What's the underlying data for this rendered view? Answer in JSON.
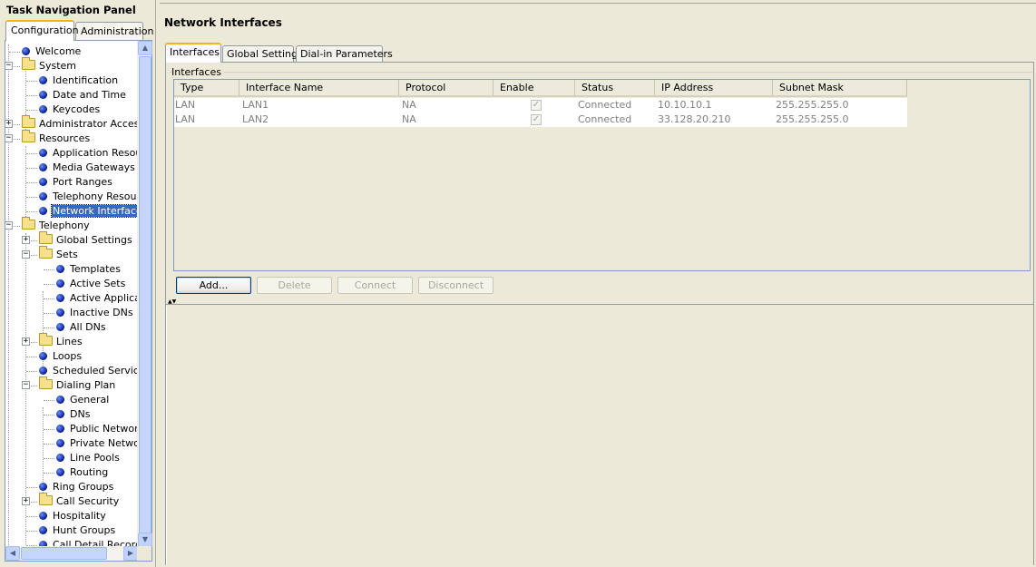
{
  "nav": {
    "title": "Task Navigation Panel",
    "tabs": [
      "Configuration",
      "Administration"
    ],
    "active_tab": "Configuration",
    "tree": [
      {
        "label": "Welcome",
        "kind": "leaf",
        "expander": ""
      },
      {
        "label": "System",
        "kind": "folder",
        "expander": "−"
      },
      {
        "label": "Identification",
        "kind": "leaf",
        "expander": ""
      },
      {
        "label": "Date and Time",
        "kind": "leaf",
        "expander": ""
      },
      {
        "label": "Keycodes",
        "kind": "leaf",
        "expander": ""
      },
      {
        "label": "Administrator Access",
        "kind": "folder",
        "expander": "+"
      },
      {
        "label": "Resources",
        "kind": "folder",
        "expander": "−"
      },
      {
        "label": "Application Resource",
        "kind": "leaf",
        "expander": ""
      },
      {
        "label": "Media Gateways",
        "kind": "leaf",
        "expander": ""
      },
      {
        "label": "Port Ranges",
        "kind": "leaf",
        "expander": ""
      },
      {
        "label": "Telephony Resource",
        "kind": "leaf",
        "expander": ""
      },
      {
        "label": "Network Interfaces",
        "kind": "leaf",
        "expander": "",
        "selected": true
      },
      {
        "label": "Telephony",
        "kind": "folder",
        "expander": "−"
      },
      {
        "label": "Global Settings",
        "kind": "folder",
        "expander": "+"
      },
      {
        "label": "Sets",
        "kind": "folder",
        "expander": "−"
      },
      {
        "label": "Templates",
        "kind": "leaf",
        "expander": ""
      },
      {
        "label": "Active Sets",
        "kind": "leaf",
        "expander": ""
      },
      {
        "label": "Active Applicatio",
        "kind": "leaf",
        "expander": ""
      },
      {
        "label": "Inactive DNs",
        "kind": "leaf",
        "expander": ""
      },
      {
        "label": "All DNs",
        "kind": "leaf",
        "expander": ""
      },
      {
        "label": "Lines",
        "kind": "folder",
        "expander": "+"
      },
      {
        "label": "Loops",
        "kind": "leaf",
        "expander": ""
      },
      {
        "label": "Scheduled Services",
        "kind": "leaf",
        "expander": ""
      },
      {
        "label": "Dialing Plan",
        "kind": "folder",
        "expander": "−"
      },
      {
        "label": "General",
        "kind": "leaf",
        "expander": ""
      },
      {
        "label": "DNs",
        "kind": "leaf",
        "expander": ""
      },
      {
        "label": "Public Network",
        "kind": "leaf",
        "expander": ""
      },
      {
        "label": "Private Network",
        "kind": "leaf",
        "expander": ""
      },
      {
        "label": "Line Pools",
        "kind": "leaf",
        "expander": ""
      },
      {
        "label": "Routing",
        "kind": "leaf",
        "expander": ""
      },
      {
        "label": "Ring Groups",
        "kind": "leaf",
        "expander": ""
      },
      {
        "label": "Call Security",
        "kind": "folder",
        "expander": "+"
      },
      {
        "label": "Hospitality",
        "kind": "leaf",
        "expander": ""
      },
      {
        "label": "Hunt Groups",
        "kind": "leaf",
        "expander": ""
      },
      {
        "label": "Call Detail Recording",
        "kind": "leaf",
        "expander": ""
      }
    ]
  },
  "main": {
    "title": "Network Interfaces",
    "tabs": [
      "Interfaces",
      "Global Settings",
      "Dial-in Parameters"
    ],
    "active_tab": "Interfaces",
    "group_label": "Interfaces",
    "columns": [
      "Type",
      "Interface Name",
      "Protocol",
      "Enable",
      "Status",
      "IP Address",
      "Subnet Mask"
    ],
    "rows": [
      {
        "type": "LAN",
        "name": "LAN1",
        "protocol": "NA",
        "enabled": true,
        "status": "Connected",
        "ip": "10.10.10.1",
        "mask": "255.255.255.0"
      },
      {
        "type": "LAN",
        "name": "LAN2",
        "protocol": "NA",
        "enabled": true,
        "status": "Connected",
        "ip": "33.128.20.210",
        "mask": "255.255.255.0"
      }
    ],
    "buttons": {
      "add": "Add...",
      "delete": "Delete",
      "connect": "Connect",
      "disconnect": "Disconnect"
    }
  },
  "icons": {
    "leaf": "blue-bullet-icon",
    "folder": "folder-icon",
    "check": "✓",
    "scroll_up": "▲",
    "scroll_down": "▼",
    "scroll_left": "◀",
    "scroll_right": "▶",
    "splitter": "▲▼"
  },
  "colors": {
    "selection": "#316ac5",
    "tab_accent": "#f9b119",
    "window_bg": "#ece9d8"
  }
}
